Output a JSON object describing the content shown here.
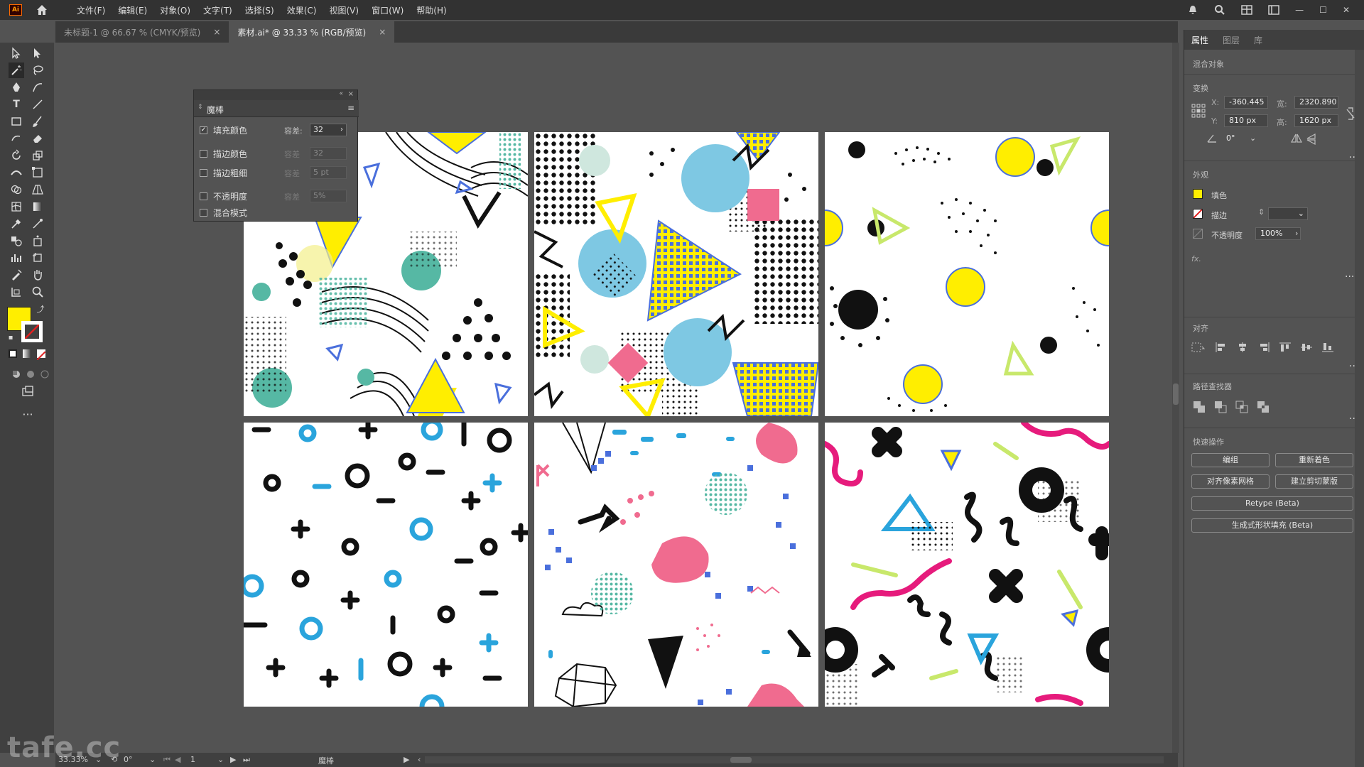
{
  "app": {
    "logo": "Ai",
    "menu": [
      "文件(F)",
      "编辑(E)",
      "对象(O)",
      "文字(T)",
      "选择(S)",
      "效果(C)",
      "视图(V)",
      "窗口(W)",
      "帮助(H)"
    ]
  },
  "tabs": [
    {
      "label": "未标题-1 @ 66.67 % (CMYK/预览)",
      "close": "×"
    },
    {
      "label": "素材.ai* @ 33.33 % (RGB/预览)",
      "close": "×"
    }
  ],
  "wand": {
    "title": "魔棒",
    "options": [
      {
        "label": "填充颜色",
        "checked": true,
        "tol_label": "容差",
        "tol_value": "32"
      },
      {
        "label": "描边颜色",
        "checked": false,
        "tol_label": "容差",
        "tol_value": "32"
      },
      {
        "label": "描边粗细",
        "checked": false,
        "tol_label": "容差",
        "tol_value": "5 pt"
      },
      {
        "label": "不透明度",
        "checked": false,
        "tol_label": "容差",
        "tol_value": "5%"
      },
      {
        "label": "混合模式",
        "checked": false
      }
    ],
    "check_mark": "✓"
  },
  "right_panel": {
    "tabs": [
      "属性",
      "图层",
      "库"
    ],
    "object_type": "混合对象",
    "transform": {
      "head": "变换",
      "x_label": "X:",
      "x": "-360.445",
      "y_label": "Y:",
      "y": "810 px",
      "w_label": "宽:",
      "w": "2320.890",
      "h_label": "高:",
      "h": "1620 px",
      "angle": "0°"
    },
    "appearance": {
      "head": "外观",
      "fill_label": "填色",
      "stroke_label": "描边",
      "opacity_label": "不透明度",
      "opacity": "100%",
      "fx": "fx."
    },
    "align_head": "对齐",
    "pathfinder_head": "路径查找器",
    "quick": {
      "head": "快速操作",
      "edit": "编组",
      "recolor": "重新着色",
      "align_pixel": "对齐像素网格",
      "clip": "建立剪切蒙版",
      "retype": "Retype (Beta)",
      "generative": "生成式形状填充 (Beta)"
    },
    "colors": {
      "fill": "#ffee00"
    }
  },
  "status": {
    "zoom": "33.33%",
    "rotation": "0°",
    "artboard": "1",
    "tool": "魔棒"
  },
  "watermark": "tafe.cc",
  "toolbar_fill": "#ffee00"
}
